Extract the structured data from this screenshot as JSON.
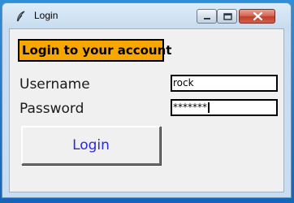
{
  "window": {
    "title": "Login",
    "icon": "feather-icon",
    "controls": [
      "minimize-icon",
      "maximize-icon",
      "close-icon"
    ]
  },
  "form": {
    "heading": "Login to your account",
    "heading_bg": "#F7A700",
    "username_label": "Username",
    "username_value": "rock",
    "password_label": "Password",
    "password_value": "*******",
    "login_button": "Login",
    "login_button_color": "#2A2AD6"
  }
}
